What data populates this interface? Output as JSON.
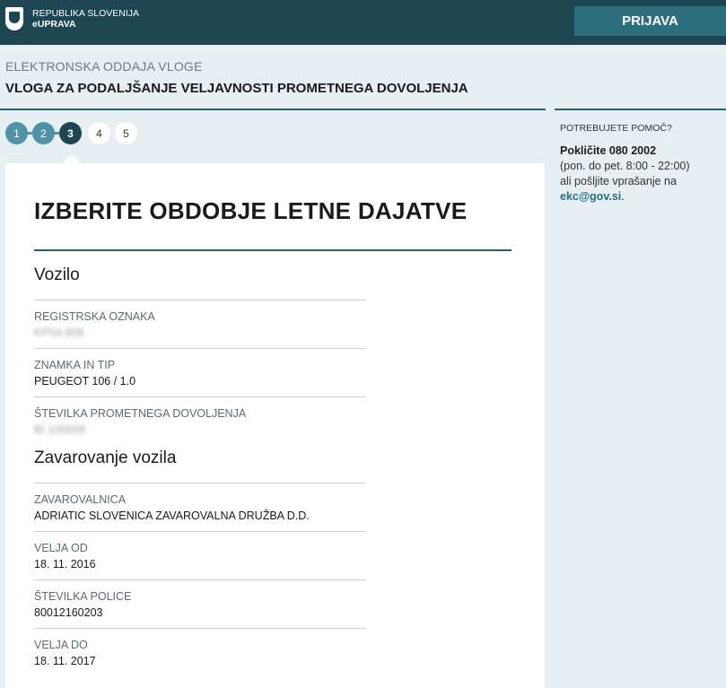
{
  "header": {
    "logo_line1": "REPUBLIKA SLOVENIJA",
    "logo_line2": "eUPRAVA",
    "login_label": "PRIJAVA"
  },
  "page": {
    "subtitle": "ELEKTRONSKA ODDAJA VLOGE",
    "title": "VLOGA ZA PODALJŠANJE VELJAVNOSTI PROMETNEGA DOVOLJENJA"
  },
  "steps": [
    {
      "label": "1",
      "state": "done"
    },
    {
      "label": "2",
      "state": "done"
    },
    {
      "label": "3",
      "state": "active"
    },
    {
      "label": "4",
      "state": "todo"
    },
    {
      "label": "5",
      "state": "todo"
    }
  ],
  "help": {
    "label": "POTREBUJETE POMOČ?",
    "phone": "Pokličite 080 2002",
    "hours": "(pon. do pet. 8:00 - 22:00)",
    "ask": "ali pošljite vprašanje na",
    "email": "ekc@gov.si",
    "email_suffix": "."
  },
  "main": {
    "heading": "IZBERITE OBDOBJE LETNE DAJATVE",
    "vehicle": {
      "title": "Vozilo",
      "fields": [
        {
          "label": "REGISTRSKA OZNAKA",
          "value": "KP54-906",
          "redacted": true
        },
        {
          "label": "ZNAMKA IN TIP",
          "value": "PEUGEOT 106 / 1.0",
          "redacted": false
        },
        {
          "label": "ŠTEVILKA PROMETNEGA DOVOLJENJA",
          "value": "BI 100609",
          "redacted": true
        }
      ]
    },
    "insurance": {
      "title": "Zavarovanje vozila",
      "fields": [
        {
          "label": "ZAVAROVALNICA",
          "value": "ADRIATIC SLOVENICA ZAVAROVALNA DRUŽBA D.D."
        },
        {
          "label": "VELJA OD",
          "value": "18. 11. 2016"
        },
        {
          "label": "ŠTEVILKA POLICE",
          "value": "80012160203"
        },
        {
          "label": "VELJA DO",
          "value": "18. 11. 2017"
        }
      ]
    }
  },
  "colors": {
    "header_bg": "#1d4552",
    "accent": "#2d6e7e",
    "step_done": "#4e93a8",
    "page_bg": "#e6eff2"
  }
}
